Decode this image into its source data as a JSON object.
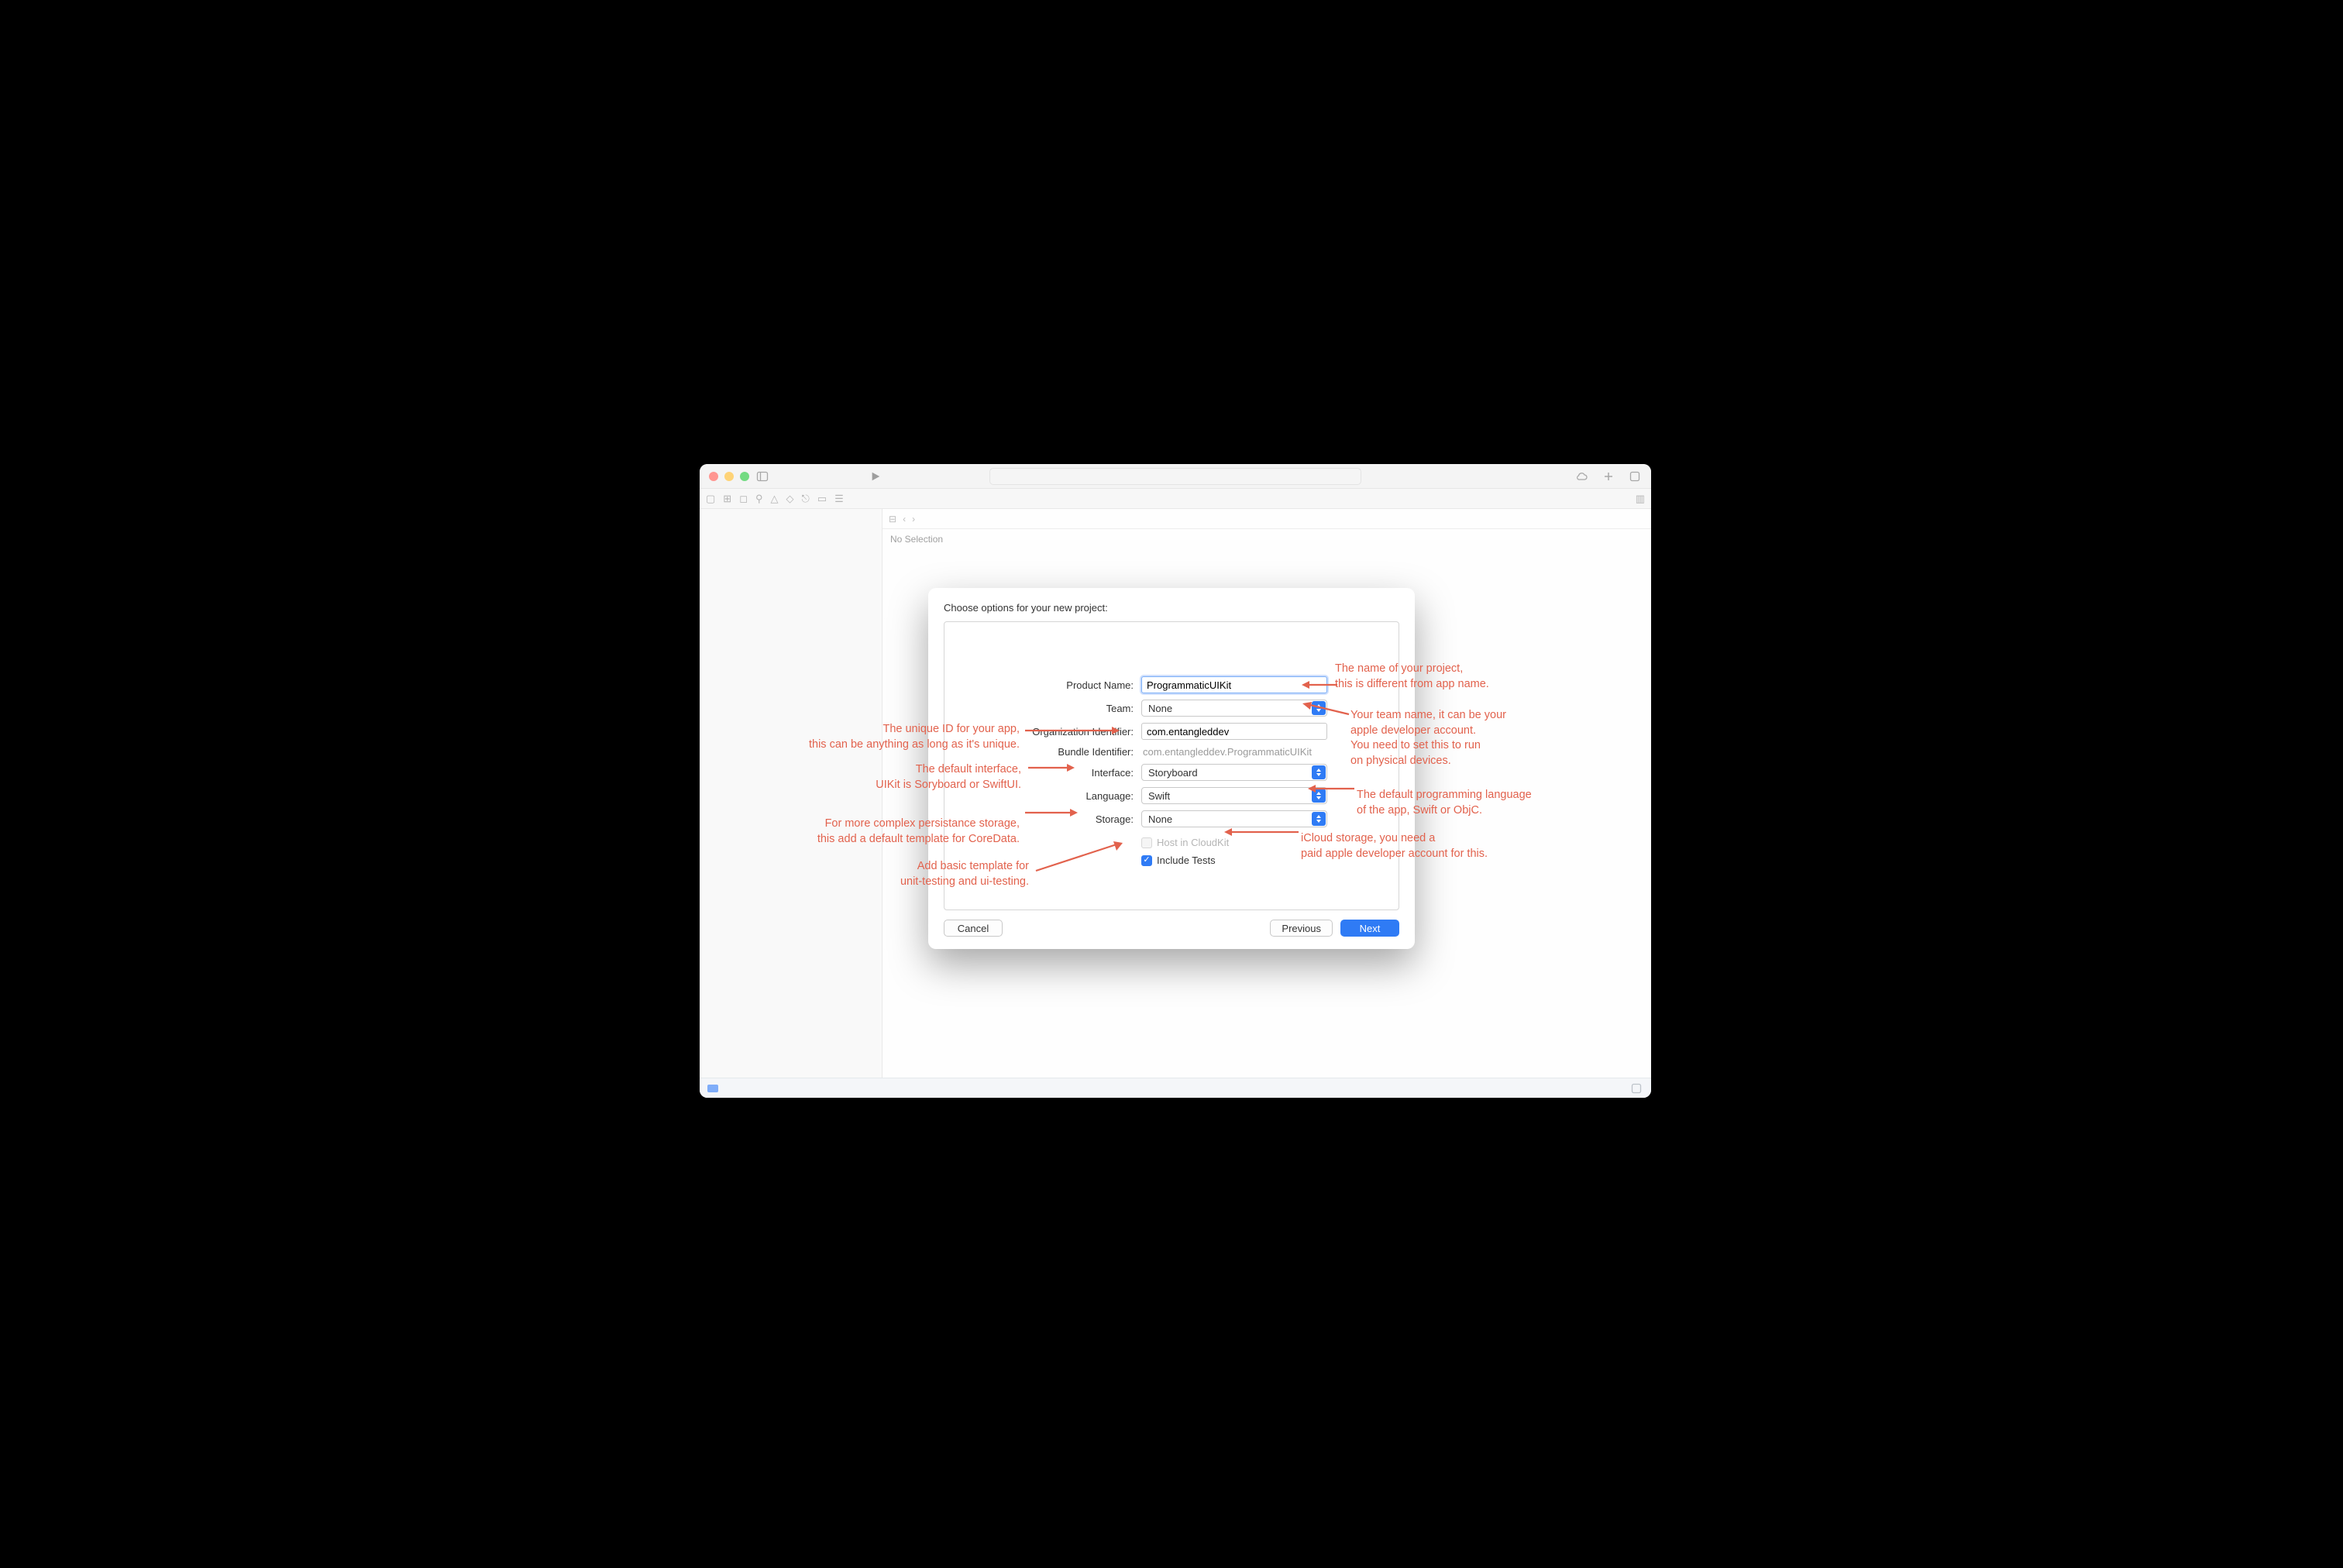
{
  "window": {
    "no_selection": "No Selection"
  },
  "sheet": {
    "title": "Choose options for your new project:",
    "labels": {
      "product_name": "Product Name:",
      "team": "Team:",
      "org_id": "Organization Identifier:",
      "bundle_id": "Bundle Identifier:",
      "interface": "Interface:",
      "language": "Language:",
      "storage": "Storage:"
    },
    "values": {
      "product_name": "ProgrammaticUIKit",
      "team": "None",
      "org_id": "com.entangleddev",
      "bundle_id": "com.entangleddev.ProgrammaticUIKit",
      "interface": "Storyboard",
      "language": "Swift",
      "storage": "None"
    },
    "checks": {
      "host_cloudkit": "Host in CloudKit",
      "include_tests": "Include Tests"
    },
    "buttons": {
      "cancel": "Cancel",
      "previous": "Previous",
      "next": "Next"
    }
  },
  "annotations": {
    "product_name": "The name of your project,\nthis is different from app name.",
    "team": "Your team name, it can be your\napple developer account.\nYou need to set this to run\non physical devices.",
    "org_id": "The unique ID for your app,\nthis can be anything as long as it's unique.",
    "interface": "The default interface,\nUIKit is Soryboard or SwiftUI.",
    "language": "The default programming language\nof the app, Swift or ObjC.",
    "storage": "For more complex persistance storage,\nthis add a default template for CoreData.",
    "cloudkit": "iCloud storage, you need a\npaid apple developer account for this.",
    "tests": "Add basic template for\nunit-testing and ui-testing."
  }
}
